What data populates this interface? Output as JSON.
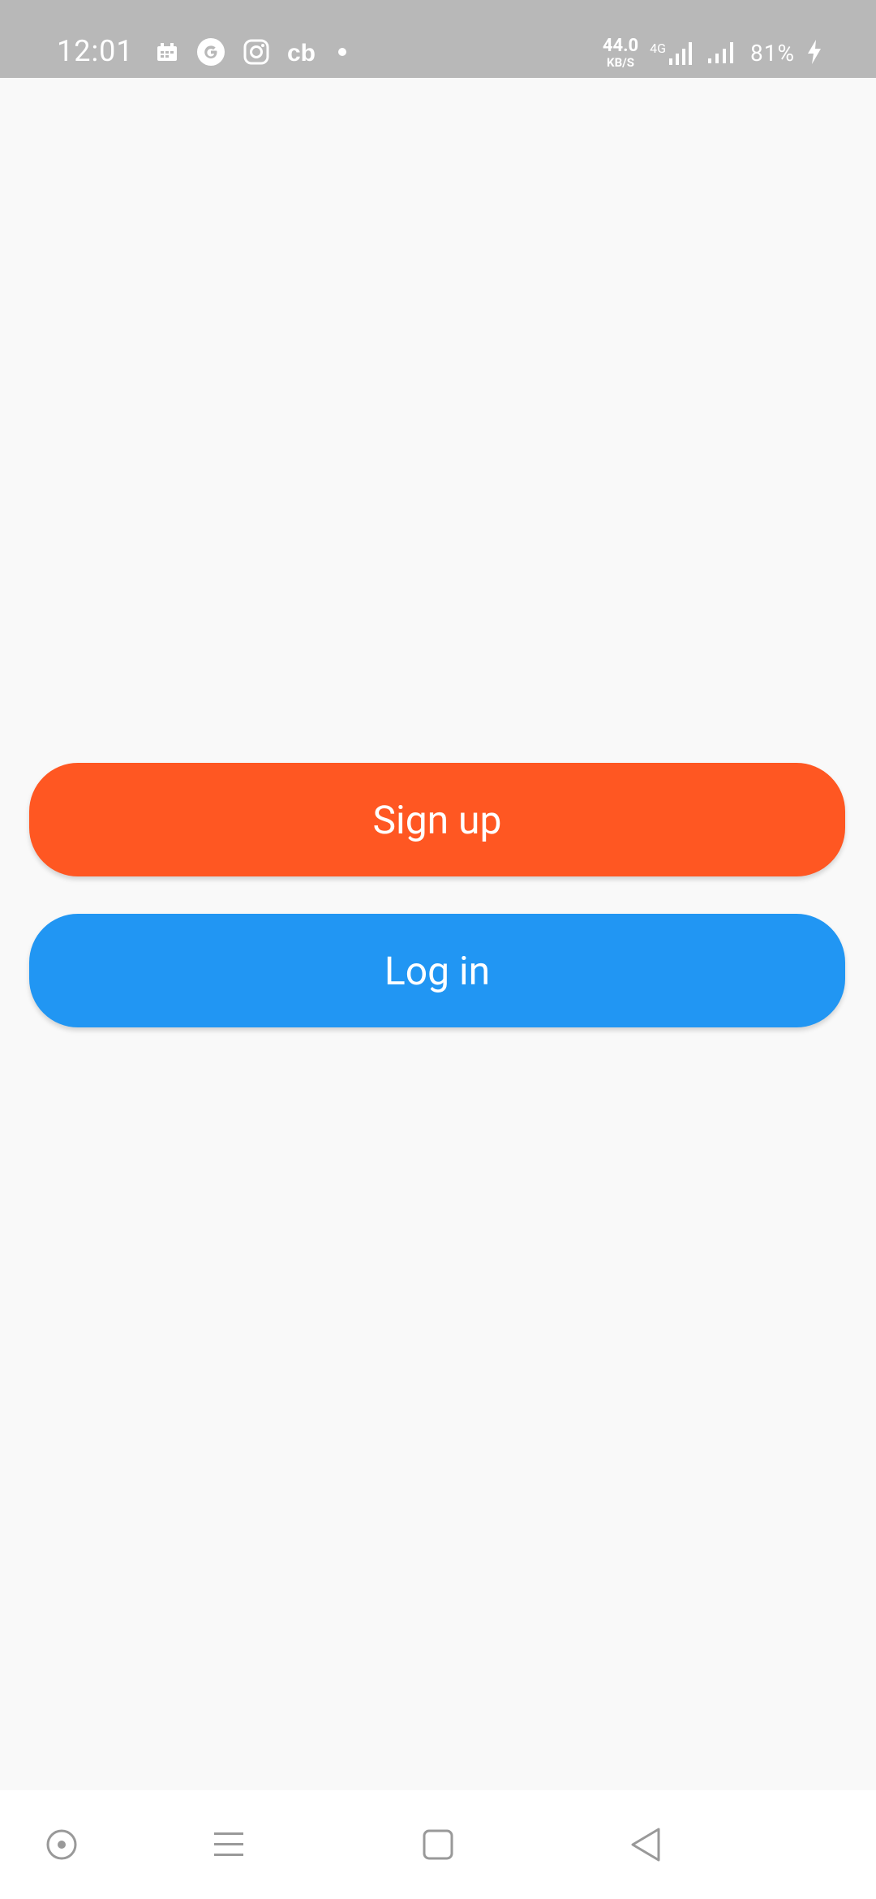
{
  "status_bar": {
    "time": "12:01",
    "net_speed": "44.0",
    "net_speed_unit": "KB/S",
    "network_type": "4G",
    "battery": "81%",
    "notification_icons": [
      "calendar-icon",
      "google-icon",
      "instagram-icon",
      "cb-icon",
      "dot-icon"
    ]
  },
  "buttons": {
    "signup_label": "Sign up",
    "login_label": "Log in",
    "signup_color": "#ff5722",
    "login_color": "#2196f3"
  },
  "nav_bar": {
    "items": [
      "assistant-icon",
      "menu-icon",
      "home-icon",
      "back-icon"
    ]
  },
  "colors": {
    "status_bar_bg": "#b8b8b8",
    "page_bg": "#f9f9f9"
  }
}
